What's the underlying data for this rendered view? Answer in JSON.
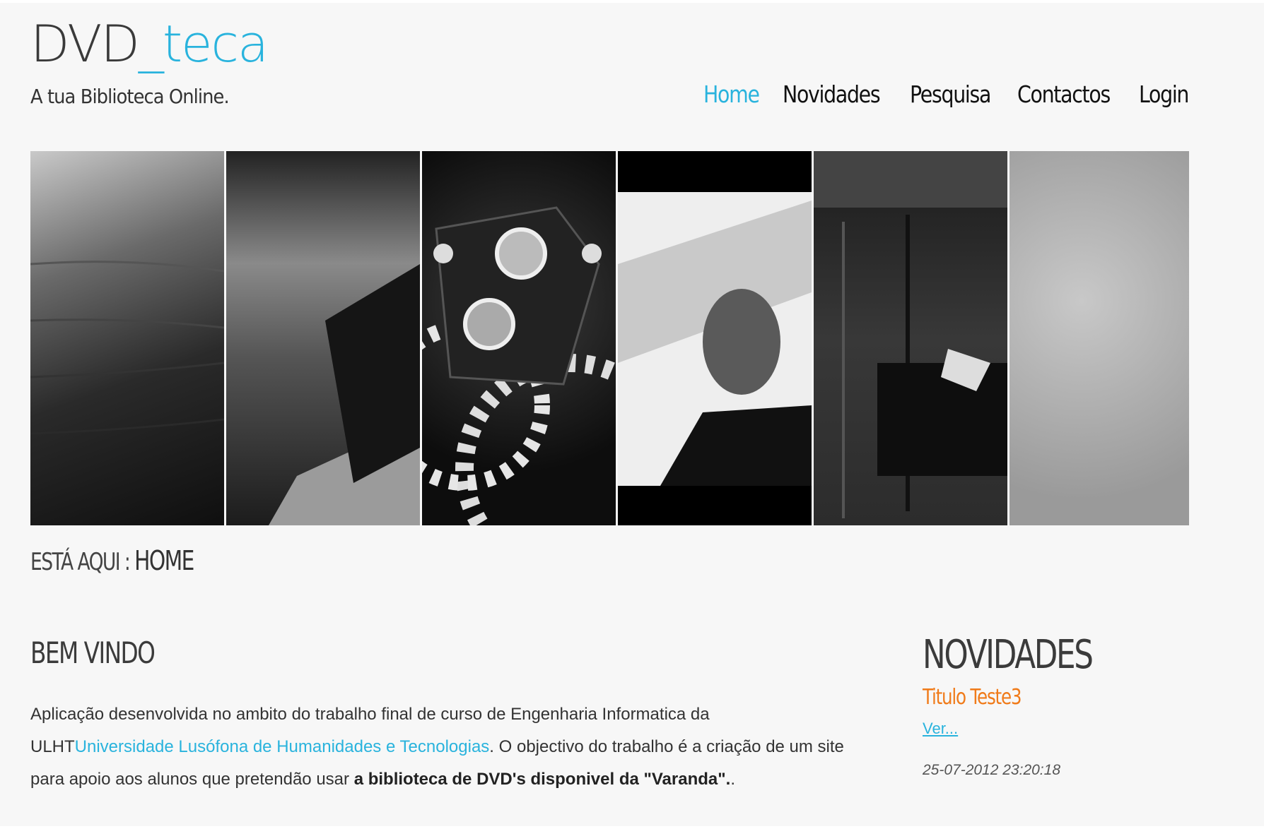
{
  "brand": {
    "logo_main": "DVD",
    "logo_accent": "_teca",
    "tagline": "A tua Biblioteca Online."
  },
  "nav": {
    "items": [
      "Home",
      "Novidades",
      "Pesquisa",
      "Contactos",
      "Login"
    ],
    "active": "Home"
  },
  "breadcrumb": {
    "prefix": "ESTÁ AQUI :",
    "current": "HOME"
  },
  "welcome": {
    "title": "BEM VINDO",
    "p1": "Aplicação desenvolvida no ambito do trabalho final de curso de Engenharia Informatica da ULHT",
    "link": "Universidade Lusófona de Humanidades e Tecnologias",
    "p2": ". O objectivo do trabalho é a criação de um site para apoio aos alunos que pretendão usar ",
    "bold": "a biblioteca de DVD's disponivel da \"Varanda\".",
    "tail": "."
  },
  "news": {
    "title": "NOVIDADES",
    "item": {
      "title": "Titulo Teste3",
      "link": "Ver...",
      "date": "25-07-2012 23:20:18"
    }
  },
  "colors": {
    "accent": "#29b3dd",
    "news_title": "#f07b1a"
  }
}
